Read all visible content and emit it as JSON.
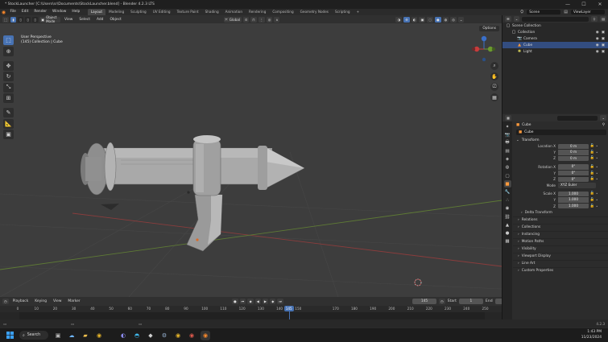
{
  "window": {
    "title": "* StockLauncher [C:\\Users\\sr\\Documents\\StockLauncher.blend] - Blender 4.2.3 LTS",
    "minimize": "—",
    "maximize": "☐",
    "close": "✕"
  },
  "menu": [
    "File",
    "Edit",
    "Render",
    "Window",
    "Help"
  ],
  "workspaces": [
    "Layout",
    "Modeling",
    "Sculpting",
    "UV Editing",
    "Texture Paint",
    "Shading",
    "Animation",
    "Rendering",
    "Compositing",
    "Geometry Nodes",
    "Scripting"
  ],
  "active_workspace": "Layout",
  "add_workspace": "+",
  "scene": {
    "name": "Scene",
    "view_layer": "ViewLayer"
  },
  "viewport_header": {
    "mode": "Object Mode",
    "menus": [
      "View",
      "Select",
      "Add",
      "Object"
    ],
    "transform_orientation": "Global",
    "options": "Options"
  },
  "viewport": {
    "view_name": "User Perspective",
    "collection_line": "(145) Collection | Cube"
  },
  "outliner": {
    "search_placeholder": "",
    "rows": [
      {
        "name": "Scene Collection",
        "icon": "collection-icon",
        "depth": 0
      },
      {
        "name": "Collection",
        "icon": "collection-icon",
        "depth": 1
      },
      {
        "name": "Camera",
        "icon": "camera-icon",
        "depth": 2
      },
      {
        "name": "Cube",
        "icon": "mesh-icon",
        "depth": 2,
        "selected": true
      },
      {
        "name": "Light",
        "icon": "light-icon",
        "depth": 2
      }
    ]
  },
  "properties": {
    "search_placeholder": "",
    "object_name": "Cube",
    "name_field": "Cube",
    "transform_title": "Transform",
    "location": {
      "label": "Location X",
      "x": "0 m",
      "y": "0 m",
      "z": "0 m"
    },
    "rotation": {
      "label": "Rotation X",
      "x": "0°",
      "y": "0°",
      "z": "0°"
    },
    "mode": {
      "label": "Mode",
      "value": "XYZ Euler"
    },
    "scale": {
      "label": "Scale X",
      "x": "1.000",
      "y": "1.000",
      "z": "1.000"
    },
    "axis_y": "Y",
    "axis_z": "Z",
    "delta_transform": "Delta Transform",
    "panels": [
      "Relations",
      "Collections",
      "Instancing",
      "Motion Paths",
      "Visibility",
      "Viewport Display",
      "Line Art",
      "Custom Properties"
    ]
  },
  "timeline": {
    "menus": [
      "Playback",
      "Keying",
      "View",
      "Marker"
    ],
    "current_frame": "145",
    "start_label": "Start",
    "start": "1",
    "end_label": "End",
    "end": "250",
    "ticks": [
      0,
      10,
      20,
      30,
      40,
      50,
      60,
      70,
      80,
      90,
      100,
      110,
      120,
      130,
      140,
      150,
      170,
      180,
      190,
      200,
      210,
      220,
      230,
      240,
      250
    ],
    "range_start": 1,
    "range_end": 250
  },
  "statusbar": {
    "version": "4.2.3"
  },
  "taskbar": {
    "search": "Search",
    "time": "1:43 PM",
    "date": "11/23/2024"
  },
  "colors": {
    "accent": "#4772b3",
    "viewport_bg": "#3d3d3d",
    "orange": "#ff8a2b"
  }
}
